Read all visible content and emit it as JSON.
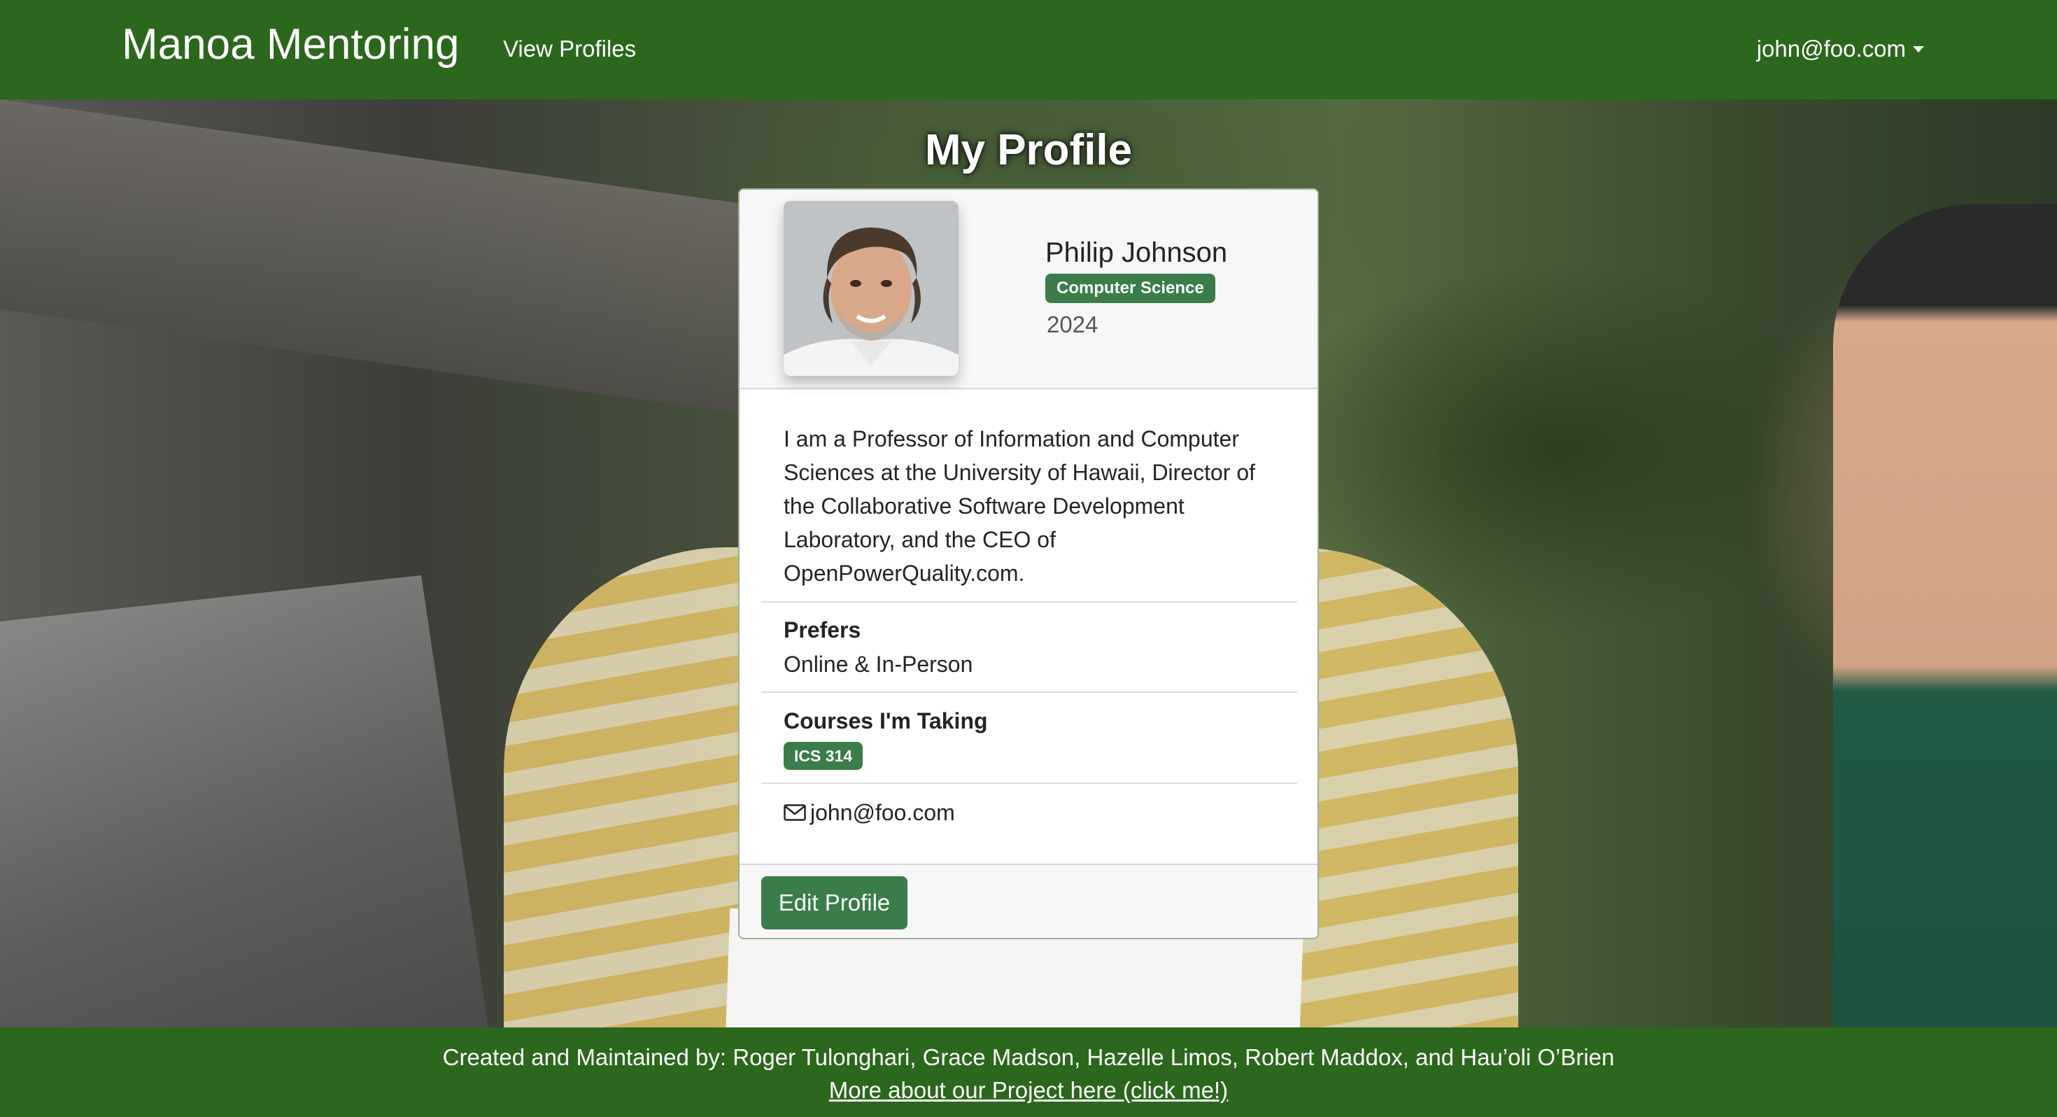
{
  "navbar": {
    "brand": "Manoa Mentoring",
    "links": [
      {
        "label": "View Profiles"
      }
    ],
    "user_email": "john@foo.com",
    "user_menu_icon": "caret-down-icon",
    "background_color": "#2b671c"
  },
  "page": {
    "title": "My Profile"
  },
  "profile": {
    "avatar_icon": "profile-photo",
    "name": "Philip Johnson",
    "department": "Computer Science",
    "year": "2024",
    "bio": "I am a Professor of Information and Computer Sciences at the University of Hawaii, Director of the Collaborative Software Development Laboratory, and the CEO of OpenPowerQuality.com.",
    "prefers_label": "Prefers",
    "prefers_value": "Online & In-Person",
    "courses_label": "Courses I'm Taking",
    "courses": [
      "ICS 314"
    ],
    "email_icon": "envelope-icon",
    "email": "john@foo.com",
    "edit_button": "Edit Profile",
    "badge_color": "#3a7d4a"
  },
  "footer": {
    "credits": "Created and Maintained by: Roger Tulonghari, Grace Madson, Hazelle Limos, Robert Maddox, and Hau’oli O’Brien",
    "link": "More about our Project here (click me!)"
  }
}
